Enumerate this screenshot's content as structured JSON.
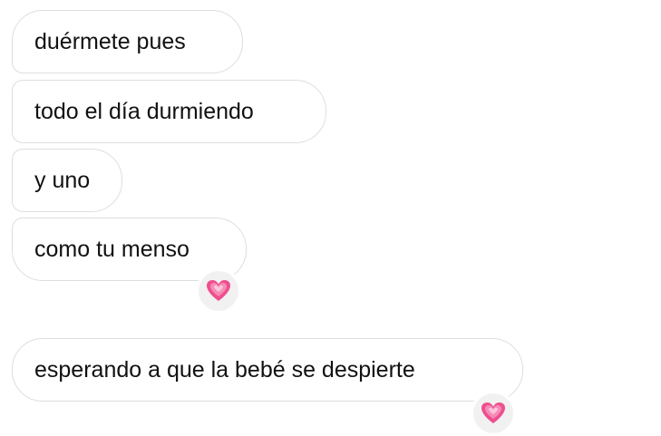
{
  "messages": [
    {
      "text": "duérmete pues"
    },
    {
      "text": "todo el día durmiendo"
    },
    {
      "text": "y uno"
    },
    {
      "text": "como tu menso",
      "reaction": "heart-icon"
    },
    {
      "text": "esperando a que la bebé se despierte",
      "reaction": "heart-icon"
    }
  ],
  "colors": {
    "bubble_border": "#dedede",
    "text": "#111111",
    "reaction_bg": "#f1f1f1",
    "heart": "#ee4f8f"
  }
}
